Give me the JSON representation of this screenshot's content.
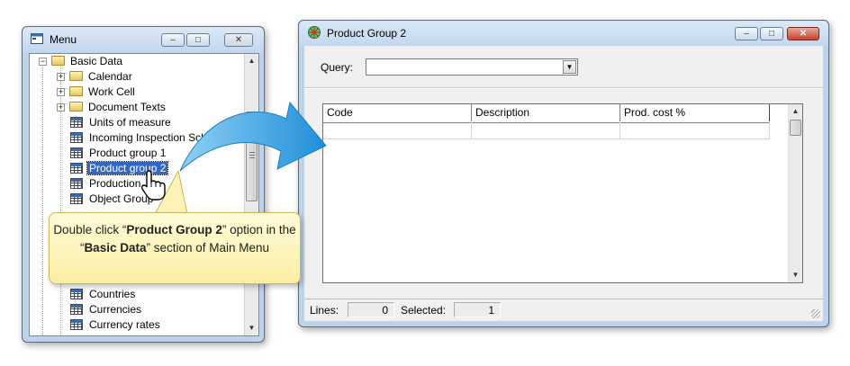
{
  "menu_window": {
    "title": "Menu",
    "minimize_glyph": "–",
    "maximize_glyph": "□",
    "close_glyph": "✕",
    "tree": {
      "root_label": "Basic Data",
      "items": [
        {
          "label": "Calendar",
          "kind": "folder",
          "expandable": true
        },
        {
          "label": "Work Cell",
          "kind": "folder",
          "expandable": true
        },
        {
          "label": "Document Texts",
          "kind": "folder",
          "expandable": true
        },
        {
          "label": "Units of measure",
          "kind": "table"
        },
        {
          "label": "Incoming Inspection Sche",
          "kind": "table"
        },
        {
          "label": "Product group 1",
          "kind": "table"
        },
        {
          "label": "Product group 2",
          "kind": "table",
          "selected": true
        },
        {
          "label": "Production",
          "kind": "table"
        },
        {
          "label": "Object Group",
          "kind": "table"
        },
        {
          "label": "Countries",
          "kind": "table"
        },
        {
          "label": "Currencies",
          "kind": "table"
        },
        {
          "label": "Currency rates",
          "kind": "table"
        }
      ]
    }
  },
  "callout": {
    "part1": "Double click “",
    "bold1": "Product Group 2",
    "part2": "” option in the “",
    "bold2": "Basic Data",
    "part3": "” section of Main Menu"
  },
  "product_group_window": {
    "title": "Product Group 2",
    "query_label": "Query:",
    "query_value": "",
    "columns": [
      "Code",
      "Description",
      "Prod. cost %"
    ],
    "status": {
      "lines_label": "Lines:",
      "lines_value": "0",
      "selected_label": "Selected:",
      "selected_value": "1"
    }
  },
  "colors": {
    "selection": "#3168c6",
    "arrow": "#2d9be0",
    "callout_fill": "#fbeea3"
  }
}
